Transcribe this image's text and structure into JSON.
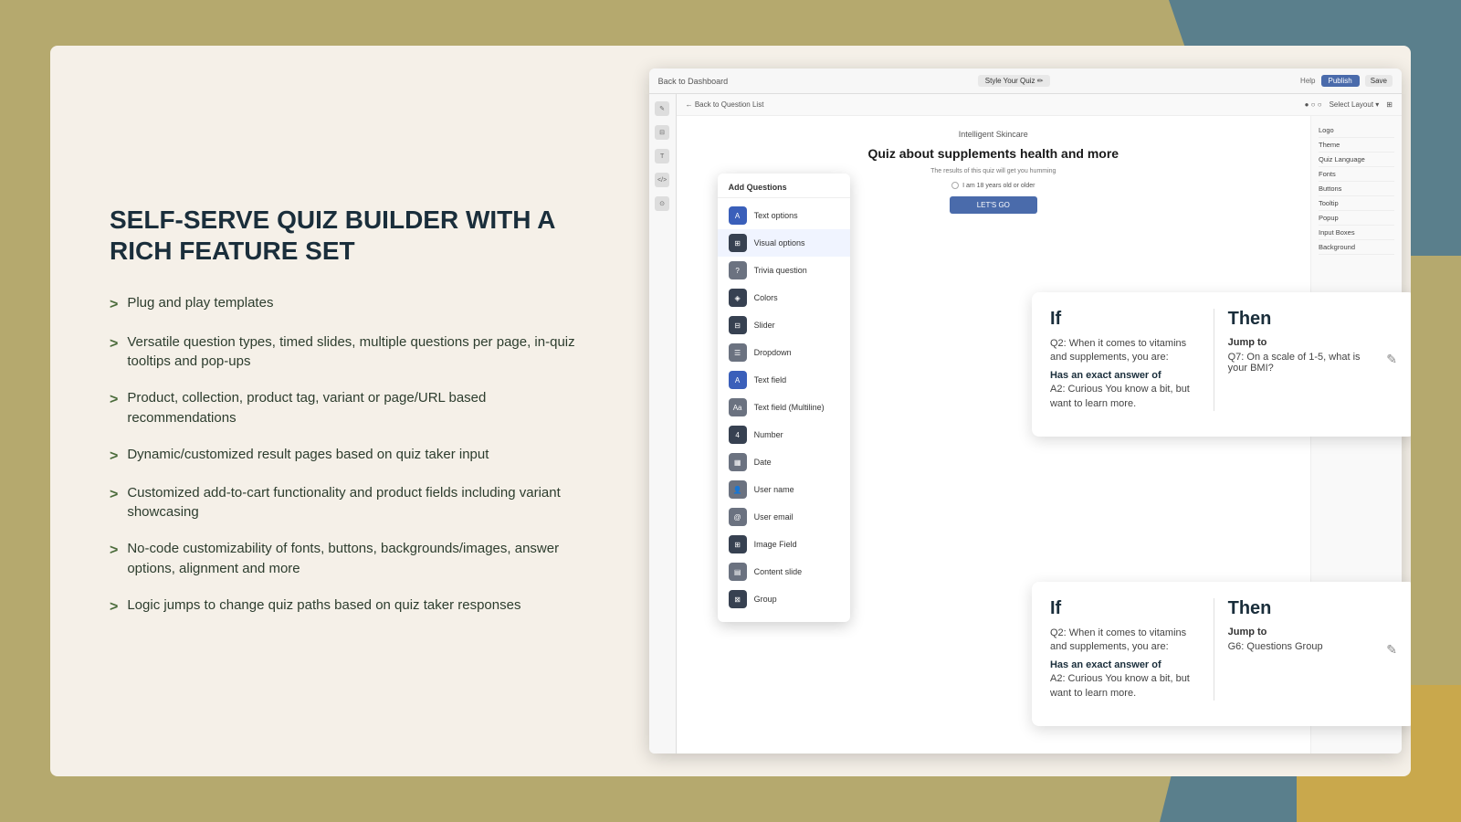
{
  "background": {
    "card_bg": "#f5f0e8"
  },
  "left_panel": {
    "title_line1": "SELF-SERVE QUIZ BUILDER WITH A",
    "title_line2": "RICH FEATURE SET",
    "features": [
      "Plug and play templates",
      "Versatile question types, timed slides, multiple questions per page, in-quiz tooltips and pop-ups",
      "Product, collection, product tag, variant or page/URL based recommendations",
      "Dynamic/customized result pages based on quiz taker input",
      "Customized add-to-cart functionality and product fields including variant showcasing",
      "No-code customizability of fonts, buttons, backgrounds/images, answer options, alignment and more",
      "Logic jumps to change quiz paths based on quiz taker responses"
    ]
  },
  "quiz_builder": {
    "topbar": {
      "back_link": "Back to Dashboard",
      "style_btn": "Style Your Quiz ✏",
      "help": "Help",
      "publish": "Publish",
      "save": "Save"
    },
    "content_topbar": {
      "back_questions": "← Back to Question List"
    },
    "quiz_preview": {
      "brand": "Intelligent Skincare",
      "title": "Quiz about supplements health and more",
      "subtitle": "The results of this quiz will get you humming",
      "checkbox_label": "I am 18 years old or older",
      "cta": "LET'S GO"
    },
    "right_panel_items": [
      "Logo",
      "Theme",
      "Quiz Language",
      "Fonts",
      "Buttons",
      "Tooltip",
      "Popup",
      "Input Boxes",
      "Background"
    ]
  },
  "add_questions": {
    "header": "Add Questions",
    "items": [
      {
        "label": "Text options",
        "icon": "A"
      },
      {
        "label": "Visual options",
        "icon": "⊞",
        "highlighted": true
      },
      {
        "label": "Trivia question",
        "icon": "?"
      },
      {
        "label": "Colors",
        "icon": "◈"
      },
      {
        "label": "Slider",
        "icon": "⊟"
      },
      {
        "label": "Dropdown",
        "icon": "☰"
      },
      {
        "label": "Text field",
        "icon": "A"
      },
      {
        "label": "Text field (Multiline)",
        "icon": "Aa"
      },
      {
        "label": "Number",
        "icon": "4"
      },
      {
        "label": "Date",
        "icon": "▦"
      },
      {
        "label": "User name",
        "icon": "👤"
      },
      {
        "label": "User email",
        "icon": "@"
      },
      {
        "label": "Image Field",
        "icon": "⊞"
      },
      {
        "label": "Content slide",
        "icon": "▤"
      },
      {
        "label": "Group",
        "icon": "⊠"
      }
    ]
  },
  "logic_cards": [
    {
      "if_label": "If",
      "then_label": "Then",
      "condition_question": "Q2: When it comes to vitamins and supplements, you are:",
      "condition_answer_label": "Has an exact answer of",
      "condition_answer": "A2: Curious You know a bit, but want to learn more.",
      "jump_to_label": "Jump to",
      "jump_to_value": "Q7: On a scale of 1-5, what is your BMI?"
    },
    {
      "if_label": "If",
      "then_label": "Then",
      "condition_question": "Q2: When it comes to vitamins and supplements, you are:",
      "condition_answer_label": "Has an exact answer of",
      "condition_answer": "A2: Curious You know a bit, but want to learn more.",
      "jump_to_label": "Jump to",
      "jump_to_value": "G6: Questions Group"
    }
  ]
}
